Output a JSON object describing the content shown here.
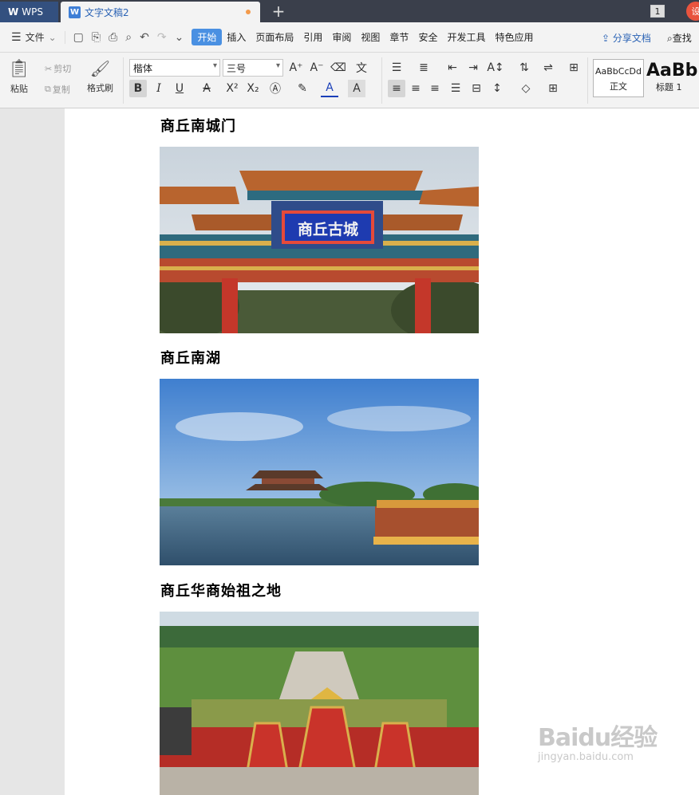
{
  "titlebar": {
    "app_tab": "WPS",
    "doc_tab": "文字文稿2",
    "new_tab_symbol": "+",
    "window_count": "1",
    "login_label": "设"
  },
  "menubar": {
    "file_label": "文件",
    "items": [
      {
        "label": "开始",
        "active": true
      },
      {
        "label": "插入"
      },
      {
        "label": "页面布局"
      },
      {
        "label": "引用"
      },
      {
        "label": "审阅"
      },
      {
        "label": "视图"
      },
      {
        "label": "章节"
      },
      {
        "label": "安全"
      },
      {
        "label": "开发工具"
      },
      {
        "label": "特色应用"
      }
    ],
    "share_label": "分享文档",
    "find_label": "查找"
  },
  "ribbon": {
    "paste_label": "粘贴",
    "cut_label": "剪切",
    "copy_label": "复制",
    "format_painter_label": "格式刷",
    "font_name": "楷体",
    "font_size": "三号",
    "styles": [
      {
        "preview": "AaBbCcDd",
        "name": "正文"
      },
      {
        "preview": "AaBb",
        "name": "标题 1"
      }
    ]
  },
  "document": {
    "sections": [
      {
        "heading": "商丘南城门",
        "image": "archway-photo"
      },
      {
        "heading": "商丘南湖",
        "image": "lake-photo"
      },
      {
        "heading": "商丘华商始祖之地",
        "image": "memorial-photo"
      }
    ],
    "sign_text": "商丘古城"
  },
  "watermark": {
    "brand": "Baidu经验",
    "url": "jingyan.baidu.com"
  },
  "colors": {
    "titlebar": "#3a3f4b",
    "active_tab": "#4a90e2",
    "accent_blue": "#2b63b5"
  }
}
